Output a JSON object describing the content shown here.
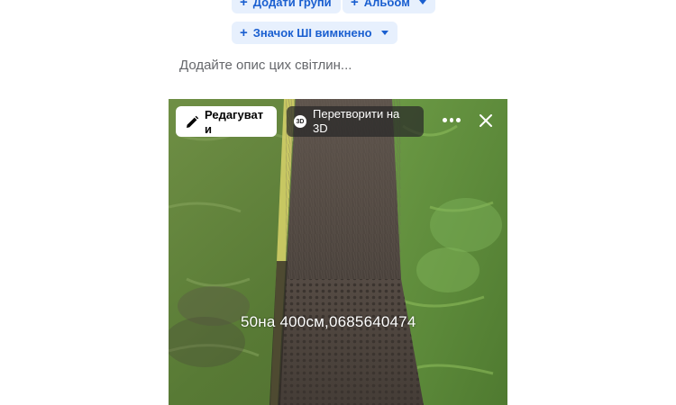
{
  "composer": {
    "add_groups_label": "Додати групи",
    "album_label": "Альбом",
    "ai_label": "Значок ШІ вимкнено",
    "description_placeholder": "Додайте опис цих світлин..."
  },
  "photo_toolbar": {
    "edit_label": "Редагувати",
    "convert_3d_label": "Перетворити на 3D",
    "badge_3d": "3D"
  },
  "photo": {
    "overlay_text": "50на 400см,0685640474"
  },
  "colors": {
    "accent": "#1a5fd0",
    "pill_background": "#e7f0fd",
    "placeholder": "#65676b"
  },
  "icons": [
    "plus-icon",
    "caret-down-icon",
    "pencil-icon",
    "badge-3d-icon",
    "more-icon",
    "close-icon"
  ]
}
